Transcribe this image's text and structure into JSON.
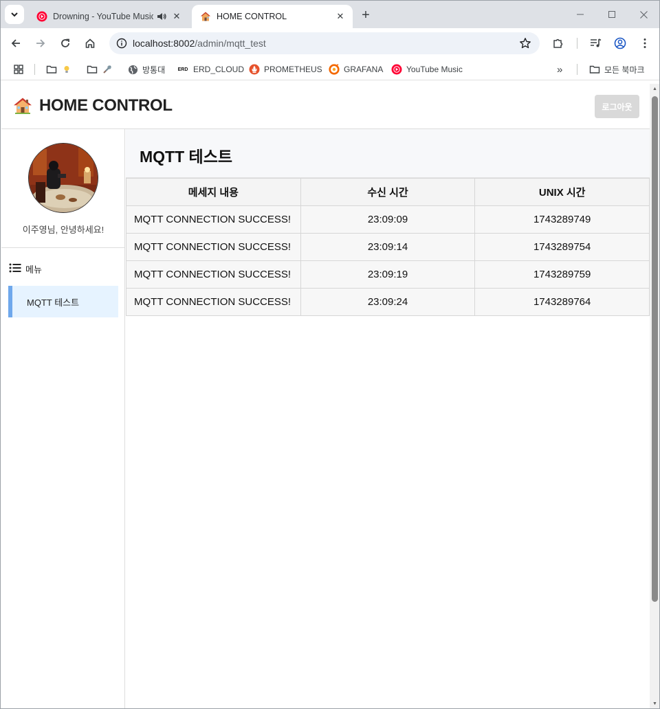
{
  "browser": {
    "tabs": [
      {
        "title": "Drowning - YouTube Music",
        "active": false,
        "audio": true
      },
      {
        "title": "HOME CONTROL",
        "active": true,
        "audio": false
      }
    ],
    "url_host": "localhost:8002",
    "url_path": "/admin/mqtt_test",
    "bookmarks": [
      {
        "label": "",
        "icon": "folder-icon"
      },
      {
        "label": "",
        "icon": "folder-icon"
      },
      {
        "label": "방통대",
        "icon": "globe-icon"
      },
      {
        "label": "ERD_CLOUD",
        "icon": "erd-icon"
      },
      {
        "label": "PROMETHEUS",
        "icon": "prometheus-icon"
      },
      {
        "label": "GRAFANA",
        "icon": "grafana-icon"
      },
      {
        "label": "YouTube Music",
        "icon": "youtube-music-icon"
      }
    ],
    "erd_badge": "ERD",
    "all_bookmarks": "모든 북마크",
    "more_bookmarks": "»"
  },
  "app": {
    "brand": "HOME CONTROL",
    "logout": "로그아웃",
    "greeting": "이주영님, 안녕하세요!",
    "menu_header": "메뉴",
    "menu_items": [
      "MQTT 테스트"
    ],
    "page_title": "MQTT 테스트",
    "table": {
      "headers": [
        "메세지 내용",
        "수신 시간",
        "UNIX 시간"
      ],
      "rows": [
        [
          "MQTT CONNECTION SUCCESS!",
          "23:09:09",
          "1743289749"
        ],
        [
          "MQTT CONNECTION SUCCESS!",
          "23:09:14",
          "1743289754"
        ],
        [
          "MQTT CONNECTION SUCCESS!",
          "23:09:19",
          "1743289759"
        ],
        [
          "MQTT CONNECTION SUCCESS!",
          "23:09:24",
          "1743289764"
        ]
      ]
    }
  },
  "colors": {
    "menu_active_bg": "#e6f3ff",
    "menu_active_accent": "#6fa8ec",
    "logout_bg": "#d9d9d9",
    "youtube_red": "#ff0033"
  }
}
